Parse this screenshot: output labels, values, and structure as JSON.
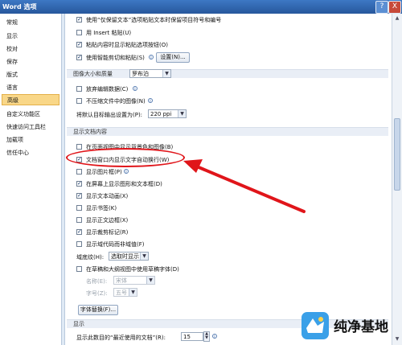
{
  "window": {
    "title": "Word 选项",
    "help_symbol": "?",
    "close_symbol": "X"
  },
  "sidebar": {
    "items": [
      {
        "label": "常规"
      },
      {
        "label": "显示"
      },
      {
        "label": "校对"
      },
      {
        "label": "保存"
      },
      {
        "label": "版式"
      },
      {
        "label": "语言"
      },
      {
        "label": "高级",
        "active": true
      },
      {
        "label": "自定义功能区"
      },
      {
        "label": "快速访问工具栏"
      },
      {
        "label": "加载项"
      },
      {
        "label": "信任中心"
      }
    ]
  },
  "editing": {
    "opt_smart_cut": "使用“仅保留文本”选项粘贴文本时保留项目符号和编号",
    "opt_insert_paste": "用 Insert 粘贴(U)",
    "opt_show_paste_btn": "粘贴内容时显示粘贴选项按钮(O)",
    "opt_smart_cut_paste": "使用智能剪切和粘贴(S)",
    "settings_button": "设置(N)..."
  },
  "image_size": {
    "section_label": "图像大小和质量",
    "document_select": "罗布泊",
    "opt_discard_edit": "放弃编辑数据(C)",
    "opt_no_compress": "不压缩文件中的图像(N)",
    "default_target_label": "将默认目标输出设置为(P):",
    "ppi_value": "220 ppi"
  },
  "show_content": {
    "section_label": "显示文档内容",
    "items": [
      {
        "label": "在页面视图中显示背景色和图像(B)",
        "checked": false
      },
      {
        "label": "文档窗口内显示文字自动换行(W)",
        "checked": true
      },
      {
        "label": "显示图片框(P)",
        "checked": false
      },
      {
        "label": "在屏幕上显示图形和文本框(D)",
        "checked": true
      },
      {
        "label": "显示文本动画(X)",
        "checked": true
      },
      {
        "label": "显示书签(K)",
        "checked": false
      },
      {
        "label": "显示正文边框(X)",
        "checked": false
      },
      {
        "label": "显示裁剪标记(R)",
        "checked": true
      },
      {
        "label": "显示域代码而非域值(F)",
        "checked": false
      }
    ],
    "field_shading_label": "域底纹(H):",
    "field_shading_value": "选取时显示",
    "opt_draft_font": "在草稿和大纲视图中使用草稿字体(D)",
    "font_name_label": "名称(E):",
    "font_name_value": "宋体",
    "font_size_label": "字号(Z):",
    "font_size_value": "五号",
    "font_sub_button": "字体替换(F)..."
  },
  "display": {
    "section_label": "显示",
    "recent_docs_label": "显示此数目的“最近使用的文档”(R):",
    "recent_docs_value": "15"
  },
  "watermark": {
    "text": "纯净基地"
  },
  "colors": {
    "annotation_red": "#e0151a",
    "selected_nav": "#f9d788"
  }
}
